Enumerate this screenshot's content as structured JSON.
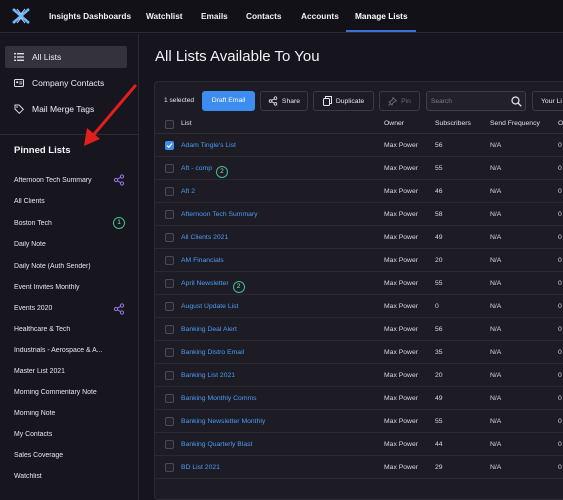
{
  "nav": {
    "items": [
      "Insights Dashboards",
      "Watchlist",
      "Emails",
      "Contacts",
      "Accounts",
      "Manage Lists"
    ],
    "active": "Manage Lists"
  },
  "sidebar": {
    "nav_items": [
      {
        "label": "All Lists",
        "icon": "list-icon",
        "active": true
      },
      {
        "label": "Company Contacts",
        "icon": "contact-card-icon",
        "active": false
      },
      {
        "label": "Mail Merge Tags",
        "icon": "tag-icon",
        "active": false
      }
    ],
    "pinned_title": "Pinned Lists",
    "pinned": [
      {
        "label": "Afternoon Tech Summary",
        "badge": "share"
      },
      {
        "label": "All Clients",
        "badge": ""
      },
      {
        "label": "Boston Tech",
        "badge": "1"
      },
      {
        "label": "Daily Note",
        "badge": ""
      },
      {
        "label": "Daily Note (Auth Sender)",
        "badge": ""
      },
      {
        "label": "Event Invites Monthly",
        "badge": ""
      },
      {
        "label": "Events 2020",
        "badge": "share"
      },
      {
        "label": "Healthcare & Tech",
        "badge": ""
      },
      {
        "label": "Industrials - Aerospace & A...",
        "badge": ""
      },
      {
        "label": "Master List 2021",
        "badge": ""
      },
      {
        "label": "Morning Commentary Note",
        "badge": ""
      },
      {
        "label": "Morning Note",
        "badge": ""
      },
      {
        "label": "My Contacts",
        "badge": ""
      },
      {
        "label": "Sales Coverage",
        "badge": ""
      },
      {
        "label": "Watchlist",
        "badge": ""
      }
    ]
  },
  "main": {
    "title": "All Lists Available To You",
    "toolbar": {
      "selected_text": "1 selected",
      "draft_email": "Draft Email",
      "share": "Share",
      "duplicate": "Duplicate",
      "pin": "Pin",
      "search_placeholder": "Search",
      "your_lists": "Your Li"
    },
    "columns": [
      "List",
      "Owner",
      "Subscribers",
      "Send Frequency",
      "O"
    ],
    "rows": [
      {
        "checked": true,
        "name": "Adam Tingle's List",
        "badge": "",
        "owner": "Max Power",
        "subscribers": "56",
        "frequency": "N/A",
        "other": "0"
      },
      {
        "checked": false,
        "name": "Aft - comp",
        "badge": "2",
        "owner": "Max Power",
        "subscribers": "55",
        "frequency": "N/A",
        "other": "0"
      },
      {
        "checked": false,
        "name": "Aft 2",
        "badge": "",
        "owner": "Max Power",
        "subscribers": "46",
        "frequency": "N/A",
        "other": "0"
      },
      {
        "checked": false,
        "name": "Afternoon Tech Summary",
        "badge": "",
        "owner": "Max Power",
        "subscribers": "58",
        "frequency": "N/A",
        "other": "0"
      },
      {
        "checked": false,
        "name": "All Clients 2021",
        "badge": "",
        "owner": "Max Power",
        "subscribers": "49",
        "frequency": "N/A",
        "other": "0"
      },
      {
        "checked": false,
        "name": "AM Financials",
        "badge": "",
        "owner": "Max Power",
        "subscribers": "20",
        "frequency": "N/A",
        "other": "0"
      },
      {
        "checked": false,
        "name": "April Newsletter",
        "badge": "2",
        "owner": "Max Power",
        "subscribers": "55",
        "frequency": "N/A",
        "other": "0"
      },
      {
        "checked": false,
        "name": "August Update List",
        "badge": "",
        "owner": "Max Power",
        "subscribers": "0",
        "frequency": "N/A",
        "other": "0"
      },
      {
        "checked": false,
        "name": "Banking Deal Alert",
        "badge": "",
        "owner": "Max Power",
        "subscribers": "56",
        "frequency": "N/A",
        "other": "0"
      },
      {
        "checked": false,
        "name": "Banking Distro Email",
        "badge": "",
        "owner": "Max Power",
        "subscribers": "35",
        "frequency": "N/A",
        "other": "0"
      },
      {
        "checked": false,
        "name": "Banking List 2021",
        "badge": "",
        "owner": "Max Power",
        "subscribers": "20",
        "frequency": "N/A",
        "other": "0"
      },
      {
        "checked": false,
        "name": "Banking Monthly Comms",
        "badge": "",
        "owner": "Max Power",
        "subscribers": "49",
        "frequency": "N/A",
        "other": "0"
      },
      {
        "checked": false,
        "name": "Banking Newsletter Monthly",
        "badge": "",
        "owner": "Max Power",
        "subscribers": "55",
        "frequency": "N/A",
        "other": "0"
      },
      {
        "checked": false,
        "name": "Banking Quarterly Blast",
        "badge": "",
        "owner": "Max Power",
        "subscribers": "44",
        "frequency": "N/A",
        "other": "0"
      },
      {
        "checked": false,
        "name": "BD List 2021",
        "badge": "",
        "owner": "Max Power",
        "subscribers": "29",
        "frequency": "N/A",
        "other": "0"
      }
    ]
  },
  "colors": {
    "accent": "#3d8cf0",
    "link": "#4d9cf4",
    "badge": "#3cc18f",
    "annotation_arrow": "#e0201c"
  }
}
